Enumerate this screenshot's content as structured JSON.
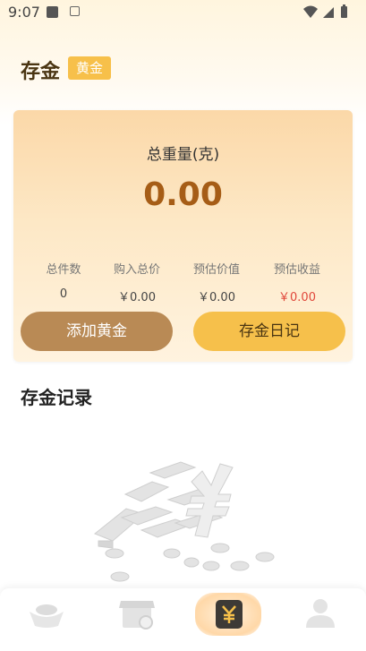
{
  "status_bar": {
    "time": "9:07"
  },
  "header": {
    "title": "存金",
    "badge": "黄金"
  },
  "summary": {
    "title": "总重量(克)",
    "value": "0.00",
    "stats": [
      {
        "label": "总件数",
        "value": "0"
      },
      {
        "label": "购入总价",
        "value": "￥0.00"
      },
      {
        "label": "预估价值",
        "value": "￥0.00"
      },
      {
        "label": "预估收益",
        "value": "￥0.00"
      }
    ],
    "add_button": "添加黄金",
    "diary_button": "存金日记"
  },
  "records": {
    "title": "存金记录"
  },
  "tabbar": {
    "tabs": [
      {
        "icon": "gold-ingot-icon"
      },
      {
        "icon": "store-icon"
      },
      {
        "icon": "yuan-icon",
        "active": true
      },
      {
        "icon": "user-icon"
      }
    ]
  },
  "colors": {
    "accent": "#f6c04b",
    "brown": "#b98a55",
    "value": "#a65d16",
    "loss": "#e0473a"
  }
}
